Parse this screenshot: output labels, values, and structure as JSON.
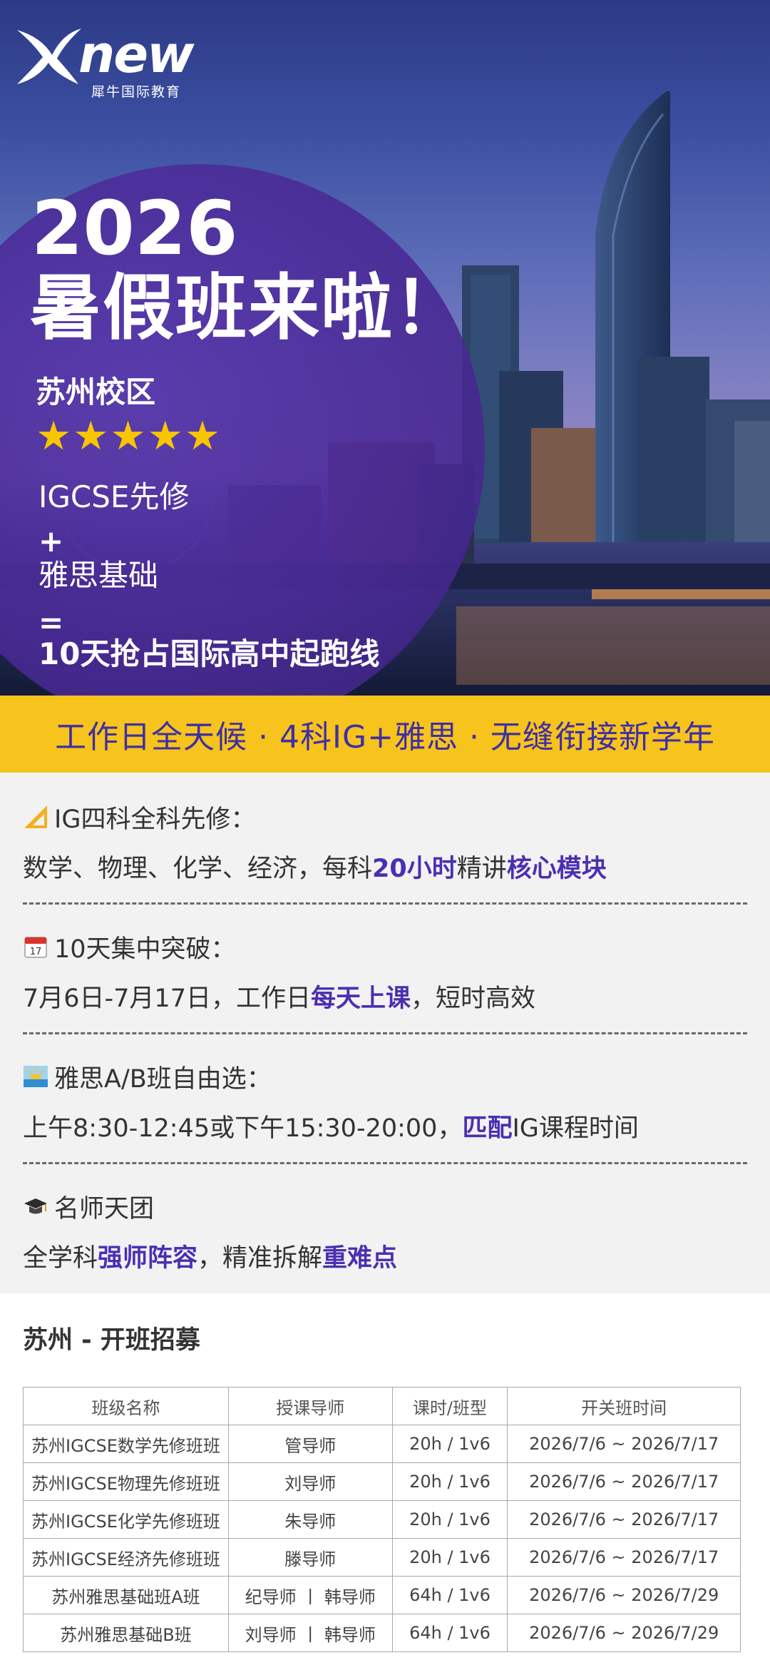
{
  "brand": {
    "name": "new",
    "subtitle": "犀牛国际教育"
  },
  "hero": {
    "year": "2026",
    "title": "暑假班来啦！",
    "campus": "苏州校区",
    "stars": "★★★★★",
    "line1": "IGCSE先修",
    "plus": "+",
    "line2": "雅思基础",
    "equals": "=",
    "line3": "10天抢占国际高中起跑线"
  },
  "banner": {
    "text": "工作日全天候 · 4科IG+雅思 · 无缝衔接新学年"
  },
  "features": [
    {
      "icon": "triangle-ruler-icon",
      "head": "IG四科全科先修：",
      "body_parts": [
        "数学、物理、化学、经济，每科",
        "20小时",
        "精讲",
        "核心模块"
      ]
    },
    {
      "icon": "calendar-icon",
      "head": "10天集中突破：",
      "body_parts": [
        "7月6日-7月17日，工作日",
        "每天上课",
        "，短时高效"
      ]
    },
    {
      "icon": "sunrise-icon",
      "head": "雅思A/B班自由选：",
      "body_parts": [
        "上午8:30-12:45或下午15:30-20:00，",
        "匹配",
        "IG课程时间"
      ]
    },
    {
      "icon": "graduation-cap-icon",
      "head": "名师天团",
      "body_parts": [
        "全学科",
        "强师阵容",
        "，精准拆解",
        "重难点"
      ]
    }
  ],
  "table": {
    "title_prefix": "苏州 - ",
    "title_main": "开班招募",
    "columns": [
      "班级名称",
      "授课导师",
      "课时/班型",
      "开关班时间"
    ],
    "rows": [
      [
        "苏州IGCSE数学先修班班",
        "管导师",
        "20h / 1v6",
        "2026/7/6 ~ 2026/7/17"
      ],
      [
        "苏州IGCSE物理先修班班",
        "刘导师",
        "20h / 1v6",
        "2026/7/6 ~ 2026/7/17"
      ],
      [
        "苏州IGCSE化学先修班班",
        "朱导师",
        "20h / 1v6",
        "2026/7/6 ~ 2026/7/17"
      ],
      [
        "苏州IGCSE经济先修班班",
        "滕导师",
        "20h / 1v6",
        "2026/7/6 ~ 2026/7/17"
      ],
      [
        "苏州雅思基础班A班",
        "纪导师 丨 韩导师",
        "64h / 1v6",
        "2026/7/6 ~ 2026/7/29"
      ],
      [
        "苏州雅思基础B班",
        "刘导师 丨 韩导师",
        "64h / 1v6",
        "2026/7/6 ~ 2026/7/29"
      ]
    ]
  },
  "colors": {
    "accent_purple": "#4b2fb2",
    "banner_yellow": "#f7c31d",
    "star_gold": "#f7c600"
  }
}
